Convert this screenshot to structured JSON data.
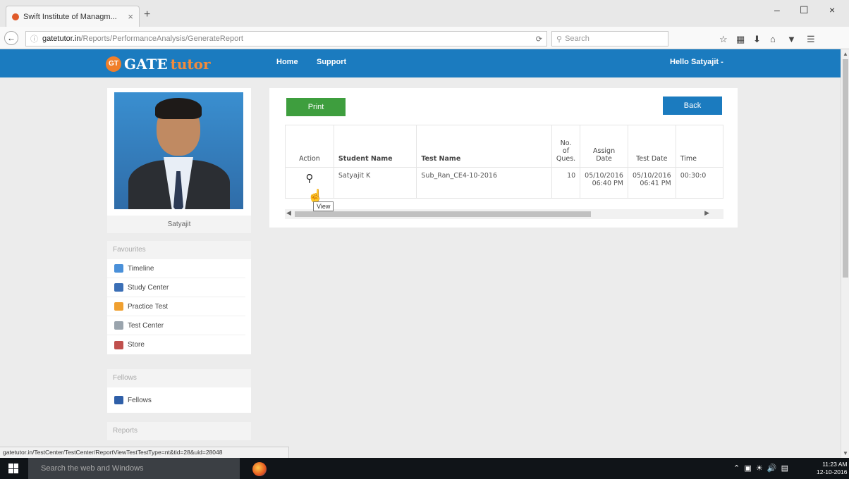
{
  "browser": {
    "tab_title": "Swift Institute of Managm...",
    "tab_close": "×",
    "new_tab": "+",
    "url_domain": "gatetutor.in",
    "url_path": "/Reports/PerformanceAnalysis/GenerateReport",
    "search_placeholder": "Search",
    "win_min": "–",
    "win_max": "☐",
    "win_close": "×"
  },
  "header": {
    "logo_badge": "GT",
    "logo_gate": "GATE",
    "logo_tutor": "tutor",
    "nav": [
      "Home",
      "Support"
    ],
    "greeting": "Hello Satyajit -"
  },
  "profile": {
    "name": "Satyajit"
  },
  "sidebar": {
    "favourites_title": "Favourites",
    "favourites": [
      {
        "label": "Timeline",
        "icon": "timeline-icon",
        "color": "#4a90d9"
      },
      {
        "label": "Study Center",
        "icon": "study-center-icon",
        "color": "#3b6fb6"
      },
      {
        "label": "Practice Test",
        "icon": "practice-test-icon",
        "color": "#f0a030"
      },
      {
        "label": "Test Center",
        "icon": "test-center-icon",
        "color": "#9aa4ad"
      },
      {
        "label": "Store",
        "icon": "store-icon",
        "color": "#c0504d"
      }
    ],
    "fellows_title": "Fellows",
    "fellows": [
      {
        "label": "Fellows",
        "icon": "fellows-icon",
        "color": "#2f5fa8"
      }
    ],
    "reports_title": "Reports"
  },
  "report": {
    "print_label": "Print",
    "back_label": "Back",
    "columns": [
      "Action",
      "Student Name",
      "Test Name",
      "No. of Ques.",
      "Assign Date",
      "Test Date",
      "Time"
    ],
    "row": {
      "student": "Satyajit K",
      "test": "Sub_Ran_CE4-10-2016",
      "questions": "10",
      "assign_date": "05/10/2016 06:40 PM",
      "test_date": "05/10/2016 06:41 PM",
      "time": "00:30:0"
    },
    "tooltip": "View"
  },
  "statusbar": "gatetutor.in/TestCenter/TestCenter/ReportViewTestTestType=nt&tid=28&uid=28048",
  "taskbar": {
    "search_placeholder": "Search the web and Windows",
    "time": "11:23 AM",
    "date": "12-10-2016"
  },
  "colors": {
    "brand_blue": "#1b7bbf",
    "print_green": "#3e9e3e",
    "logo_orange": "#f07f2a"
  }
}
